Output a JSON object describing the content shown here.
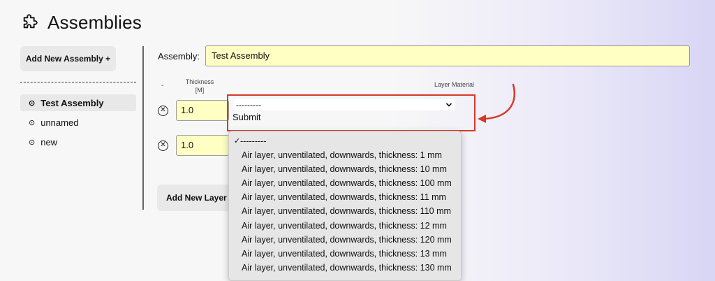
{
  "header": {
    "title": "Assemblies",
    "icon": "puzzle-icon"
  },
  "sidebar": {
    "add_label": "Add New Assembly +",
    "items": [
      {
        "label": "Test Assembly",
        "selected": true
      },
      {
        "label": "unnamed",
        "selected": false
      },
      {
        "label": "new",
        "selected": false
      }
    ]
  },
  "form": {
    "assembly_label": "Assembly:",
    "assembly_value": "Test Assembly",
    "col_remove": "-",
    "col_thickness": "Thickness",
    "col_thickness_unit": "[M]",
    "col_material": "Layer Material",
    "layers": [
      {
        "thickness": "1.0"
      },
      {
        "thickness": "1.0"
      }
    ],
    "select_value": "---------",
    "submit_label": "Submit",
    "add_layer_label": "Add New Layer +"
  },
  "dropdown": {
    "checkmark": "✓",
    "options": [
      "---------",
      "Air layer, unventilated, downwards, thickness: 1 mm",
      "Air layer, unventilated, downwards, thickness: 10 mm",
      "Air layer, unventilated, downwards, thickness: 100 mm",
      "Air layer, unventilated, downwards, thickness: 11 mm",
      "Air layer, unventilated, downwards, thickness: 110 mm",
      "Air layer, unventilated, downwards, thickness: 12 mm",
      "Air layer, unventilated, downwards, thickness: 120 mm",
      "Air layer, unventilated, downwards, thickness: 13 mm",
      "Air layer, unventilated, downwards, thickness: 130 mm"
    ]
  },
  "annotation": {
    "color": "#d63a26"
  }
}
